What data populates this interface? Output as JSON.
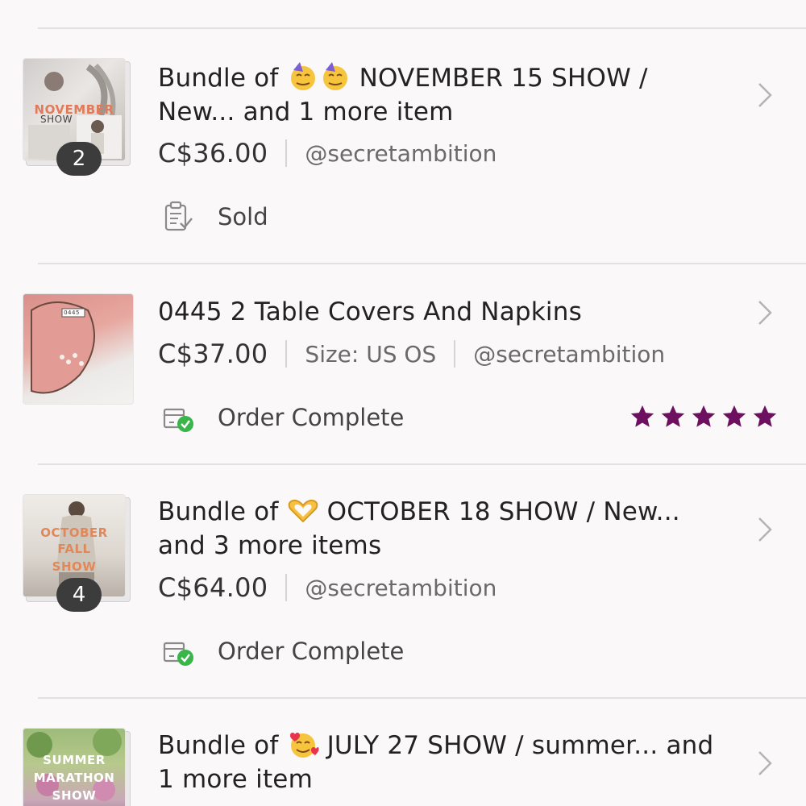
{
  "orders": [
    {
      "title": "Bundle of 🥳🥳 NOVEMBER 15 SHOW / New... and 1 more item",
      "title_line1_prefix": "Bundle of",
      "title_line1_suffix": "NOVEMBER 15 SHOW /",
      "title_line2": "New... and 1 more item",
      "emojis": [
        "partying-face-emoji",
        "partying-face-emoji"
      ],
      "thumb_text": [
        "NOVEMBER",
        "SHOW"
      ],
      "item_count": "2",
      "price": "C$36.00",
      "seller": "@secretambition",
      "status": "Sold",
      "status_icon": "clipboard-check-icon"
    },
    {
      "title": "0445 2 Table Covers And Napkins",
      "thumb_text": [
        "0445"
      ],
      "price": "C$37.00",
      "size": "Size: US OS",
      "seller": "@secretambition",
      "status": "Order Complete",
      "status_icon": "box-check-icon",
      "rating": 5,
      "rating_color": "#6e1060"
    },
    {
      "title": "Bundle of 🫶 OCTOBER 18 SHOW / New... and 3 more items",
      "title_line1_prefix": "Bundle of",
      "title_line1_suffix": "OCTOBER 18 SHOW / New...",
      "title_line2": "and 3 more items",
      "emojis": [
        "heart-hands-emoji"
      ],
      "thumb_text": [
        "OCTOBER",
        "FALL",
        "SHOW"
      ],
      "item_count": "4",
      "price": "C$64.00",
      "seller": "@secretambition",
      "status": "Order Complete",
      "status_icon": "box-check-icon"
    },
    {
      "title": "Bundle of 🥰 JULY 27 SHOW / summer... and 1 more item",
      "title_line1_prefix": "Bundle of",
      "title_line1_suffix": "JULY 27 SHOW / summer... and",
      "title_line2": "1 more item",
      "emojis": [
        "smiling-face-with-hearts-emoji"
      ],
      "thumb_text": [
        "SUMMER",
        "MARATHON",
        "SHOW"
      ]
    }
  ],
  "colors": {
    "background": "#faf8f9",
    "divider": "#e3e0e2",
    "accent_green": "#3ab54a",
    "star": "#6e1060"
  }
}
